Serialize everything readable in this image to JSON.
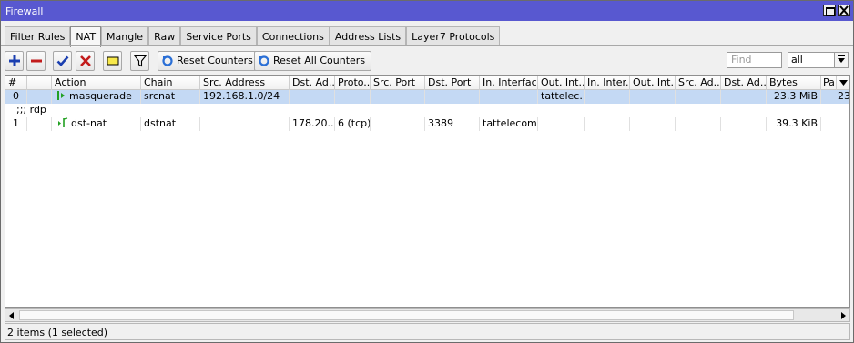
{
  "window": {
    "title": "Firewall"
  },
  "tabs": [
    {
      "label": "Filter Rules",
      "active": false
    },
    {
      "label": "NAT",
      "active": true
    },
    {
      "label": "Mangle",
      "active": false
    },
    {
      "label": "Raw",
      "active": false
    },
    {
      "label": "Service Ports",
      "active": false
    },
    {
      "label": "Connections",
      "active": false
    },
    {
      "label": "Address Lists",
      "active": false
    },
    {
      "label": "Layer7 Protocols",
      "active": false
    }
  ],
  "toolbar": {
    "reset_counters": "Reset Counters",
    "reset_all_counters": "Reset All Counters",
    "find_placeholder": "Find",
    "filter_value": "all"
  },
  "table": {
    "headers": {
      "num": "#",
      "action": "Action",
      "chain": "Chain",
      "src_address": "Src. Address",
      "dst_address": "Dst. Ad...",
      "protocol": "Proto...",
      "src_port": "Src. Port",
      "dst_port": "Dst. Port",
      "in_interface": "In. Interface",
      "out_interface": "Out. Int...",
      "in_interface_list": "In. Inter...",
      "out_interface_list": "Out. Int...",
      "src_address_list": "Src. Ad...",
      "dst_address_list": "Dst. Ad...",
      "bytes": "Bytes",
      "packets": "Pa"
    },
    "rows": [
      {
        "num": "0",
        "action": "masquerade",
        "chain": "srcnat",
        "src_address": "192.168.1.0/24",
        "dst_address": "",
        "protocol": "",
        "src_port": "",
        "dst_port": "",
        "in_interface": "",
        "out_interface": "tattelec...",
        "in_interface_list": "",
        "out_interface_list": "",
        "src_address_list": "",
        "dst_address_list": "",
        "bytes": "23.3 MiB",
        "packets": "23"
      },
      {
        "comment": ";;; rdp",
        "num": "1",
        "action": "dst-nat",
        "chain": "dstnat",
        "src_address": "",
        "dst_address": "178.20...",
        "protocol": "6 (tcp)",
        "src_port": "",
        "dst_port": "3389",
        "in_interface": "tattelecom",
        "out_interface": "",
        "in_interface_list": "",
        "out_interface_list": "",
        "src_address_list": "",
        "dst_address_list": "",
        "bytes": "39.3 KiB",
        "packets": ""
      }
    ]
  },
  "status": {
    "text": "2 items (1 selected)"
  },
  "colors": {
    "titlebar": "#5858d0",
    "selection": "#c4d9f4"
  }
}
